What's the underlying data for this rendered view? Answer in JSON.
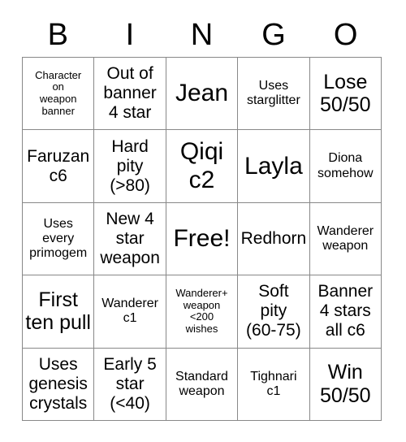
{
  "card": {
    "headers": [
      "B",
      "I",
      "N",
      "G",
      "O"
    ],
    "cells": [
      {
        "text": "Character\non\nweapon\nbanner",
        "size": "xs"
      },
      {
        "text": "Out of\nbanner\n4 star",
        "size": "md"
      },
      {
        "text": "Jean",
        "size": "xl"
      },
      {
        "text": "Uses\nstarglitter",
        "size": "sm"
      },
      {
        "text": "Lose\n50/50",
        "size": "lg"
      },
      {
        "text": "Faruzan\nc6",
        "size": "md"
      },
      {
        "text": "Hard\npity\n(>80)",
        "size": "md"
      },
      {
        "text": "Qiqi\nc2",
        "size": "xl"
      },
      {
        "text": "Layla",
        "size": "xl"
      },
      {
        "text": "Diona\nsomehow",
        "size": "sm"
      },
      {
        "text": "Uses\nevery\nprimogem",
        "size": "sm"
      },
      {
        "text": "New 4\nstar\nweapon",
        "size": "md"
      },
      {
        "text": "Free!",
        "size": "xl"
      },
      {
        "text": "Redhorn",
        "size": "md"
      },
      {
        "text": "Wanderer\nweapon",
        "size": "sm"
      },
      {
        "text": "First\nten pull",
        "size": "lg"
      },
      {
        "text": "Wanderer\nc1",
        "size": "sm"
      },
      {
        "text": "Wanderer+\nweapon\n<200\nwishes",
        "size": "xs"
      },
      {
        "text": "Soft\npity\n(60-75)",
        "size": "md"
      },
      {
        "text": "Banner\n4 stars\nall c6",
        "size": "md"
      },
      {
        "text": "Uses\ngenesis\ncrystals",
        "size": "md"
      },
      {
        "text": "Early 5\nstar\n(<40)",
        "size": "md"
      },
      {
        "text": "Standard\nweapon",
        "size": "sm"
      },
      {
        "text": "Tighnari\nc1",
        "size": "sm"
      },
      {
        "text": "Win\n50/50",
        "size": "lg"
      }
    ]
  },
  "colors": {
    "border": "#888888",
    "text": "#000000",
    "background": "#ffffff"
  }
}
